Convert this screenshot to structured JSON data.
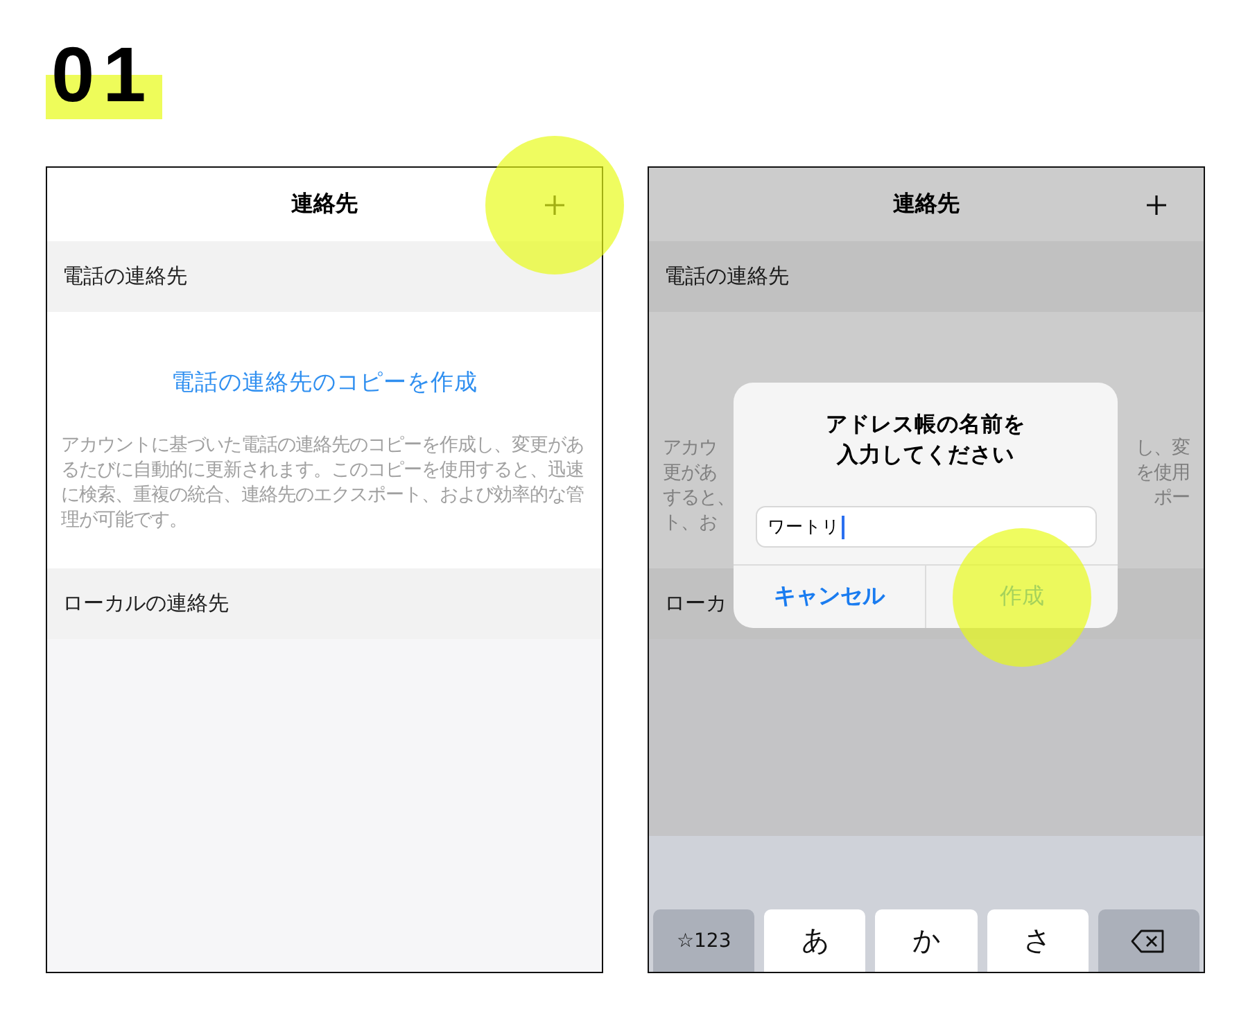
{
  "step": "01",
  "screens": [
    {
      "title": "連絡先",
      "add_button": {
        "highlighted": true
      },
      "sections": [
        {
          "header": "電話の連絡先",
          "link": "電話の連絡先のコピーを作成",
          "description": "アカウントに基づいた電話の連絡先のコピーを作成し、変更があるたびに自動的に更新されます。このコピーを使用すると、迅速に検索、重複の統合、連絡先のエクスポート、および効率的な管理が可能です。"
        },
        {
          "header": "ローカルの連絡先"
        }
      ]
    },
    {
      "title": "連絡先",
      "add_button": {
        "highlighted": false
      },
      "sections": [
        {
          "header": "電話の連絡先",
          "description_fragments": [
            {
              "left": "アカウ",
              "right": "し、変"
            },
            {
              "left": "更があ",
              "right": "を使用"
            },
            {
              "left": "すると、",
              "right": "ポー"
            },
            {
              "left": "ト、お"
            }
          ]
        },
        {
          "header": "ローカ"
        }
      ],
      "dialog": {
        "title_lines": [
          "アドレス帳の名前を",
          "入力してください"
        ],
        "input_value": "ワートリ",
        "buttons": [
          {
            "label": "キャンセル",
            "bold": true,
            "highlighted": false
          },
          {
            "label": "作成",
            "bold": false,
            "highlighted": true
          }
        ]
      },
      "keyboard": {
        "keys": [
          {
            "kind": "function",
            "label": "☆123"
          },
          {
            "kind": "char",
            "label": "あ"
          },
          {
            "kind": "char",
            "label": "か"
          },
          {
            "kind": "char",
            "label": "さ"
          },
          {
            "kind": "delete"
          }
        ]
      }
    }
  ]
}
